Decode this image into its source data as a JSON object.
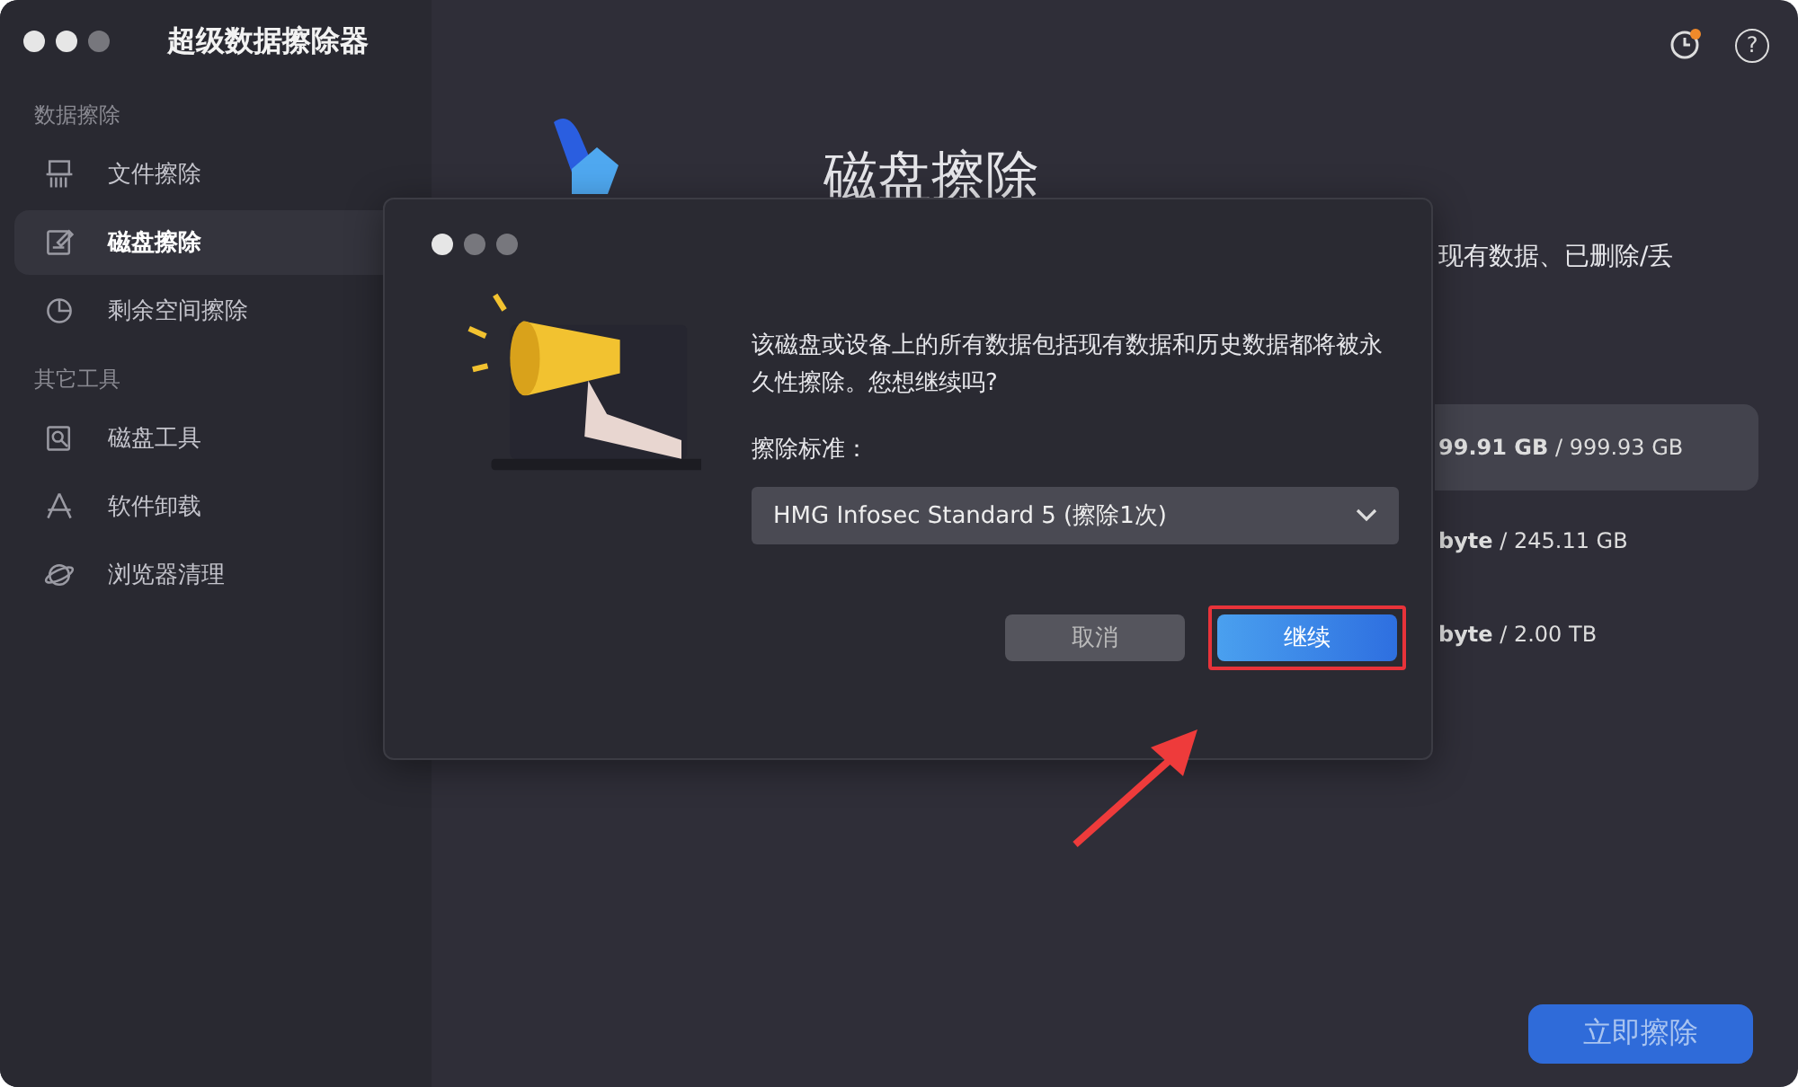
{
  "window": {
    "title": "超级数据擦除器"
  },
  "toolbar": {
    "help": "?"
  },
  "sidebar": {
    "sections": [
      {
        "title": "数据擦除",
        "items": [
          {
            "label": "文件擦除",
            "kind": "shredder",
            "selected": false
          },
          {
            "label": "磁盘擦除",
            "kind": "disk",
            "selected": true
          },
          {
            "label": "剩余空间擦除",
            "kind": "pie",
            "selected": false
          }
        ]
      },
      {
        "title": "其它工具",
        "items": [
          {
            "label": "磁盘工具",
            "kind": "tool",
            "selected": false
          },
          {
            "label": "软件卸载",
            "kind": "apps",
            "selected": false
          },
          {
            "label": "浏览器清理",
            "kind": "planet",
            "selected": false
          }
        ]
      }
    ]
  },
  "main": {
    "title": "磁盘擦除",
    "description": "现有数据、已删除/丢",
    "drives": [
      {
        "usage": "**99.91 GB** / 999.93 GB",
        "selected": true
      },
      {
        "usage": "**byte** / 245.11 GB",
        "selected": false
      },
      {
        "usage": "**byte** / 2.00 TB",
        "selected": false
      }
    ],
    "erase_button": "立即擦除"
  },
  "dialog": {
    "message": "该磁盘或设备上的所有数据包括现有数据和历史数据都将被永久性擦除。您想继续吗?",
    "standard_label": "擦除标准：",
    "standard_value": "HMG Infosec Standard 5 (擦除1次)",
    "buttons": [
      {
        "label": "取消",
        "kind": "secondary"
      },
      {
        "label": "继续",
        "kind": "primary",
        "highlighted": true
      }
    ]
  }
}
